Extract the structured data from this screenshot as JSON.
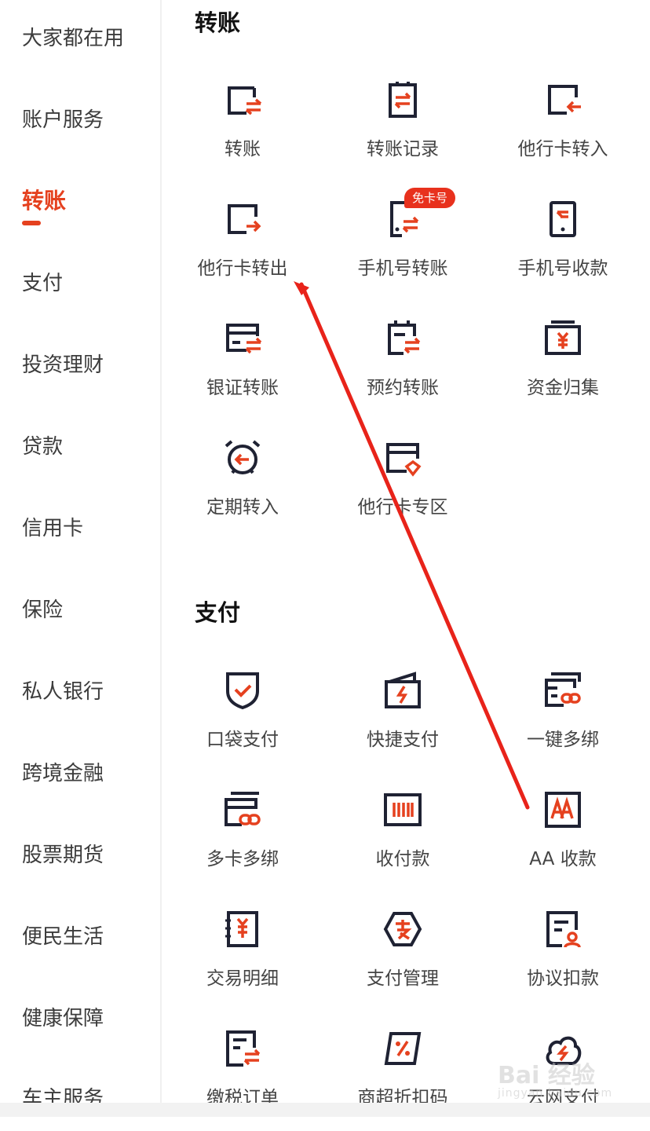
{
  "sidebar": {
    "items": [
      {
        "label": "大家都在用"
      },
      {
        "label": "账户服务"
      },
      {
        "label": "转账",
        "active": true
      },
      {
        "label": "支付"
      },
      {
        "label": "投资理财"
      },
      {
        "label": "贷款"
      },
      {
        "label": "信用卡"
      },
      {
        "label": "保险"
      },
      {
        "label": "私人银行"
      },
      {
        "label": "跨境金融"
      },
      {
        "label": "股票期货"
      },
      {
        "label": "便民生活"
      },
      {
        "label": "健康保障"
      },
      {
        "label": "车主服务"
      }
    ]
  },
  "sections": [
    {
      "title": "转账",
      "items": [
        {
          "label": "转账",
          "icon": "card-transfer-icon"
        },
        {
          "label": "转账记录",
          "icon": "transfer-record-icon"
        },
        {
          "label": "他行卡转入",
          "icon": "card-in-icon"
        },
        {
          "label": "他行卡转出",
          "icon": "card-out-icon"
        },
        {
          "label": "手机号转账",
          "icon": "phone-transfer-icon",
          "badge": "免卡号"
        },
        {
          "label": "手机号收款",
          "icon": "phone-receive-icon"
        },
        {
          "label": "银证转账",
          "icon": "securities-transfer-icon"
        },
        {
          "label": "预约转账",
          "icon": "scheduled-transfer-icon"
        },
        {
          "label": "资金归集",
          "icon": "fund-collection-icon"
        },
        {
          "label": "定期转入",
          "icon": "alarm-clock-icon"
        },
        {
          "label": "他行卡专区",
          "icon": "card-zone-icon"
        }
      ]
    },
    {
      "title": "支付",
      "items": [
        {
          "label": "口袋支付",
          "icon": "shield-check-icon"
        },
        {
          "label": "快捷支付",
          "icon": "wallet-bolt-icon"
        },
        {
          "label": "一键多绑",
          "icon": "card-link-icon"
        },
        {
          "label": "多卡多绑",
          "icon": "multi-card-link-icon"
        },
        {
          "label": "收付款",
          "icon": "barcode-icon"
        },
        {
          "label": "AA 收款",
          "icon": "aa-icon"
        },
        {
          "label": "交易明细",
          "icon": "yuan-book-icon"
        },
        {
          "label": "支付管理",
          "icon": "hexagon-pay-icon"
        },
        {
          "label": "协议扣款",
          "icon": "document-person-icon"
        },
        {
          "label": "缴税订单",
          "icon": "tax-order-icon"
        },
        {
          "label": "商超折扣码",
          "icon": "discount-code-icon"
        },
        {
          "label": "云网支付",
          "icon": "cloud-pay-icon"
        }
      ]
    }
  ],
  "watermark": {
    "brand": "Bai 经验",
    "sub": "jingyan.baidu.com"
  },
  "colors": {
    "accent": "#e5411f",
    "icon_dark": "#1f2233",
    "annotation": "#e8231a"
  }
}
